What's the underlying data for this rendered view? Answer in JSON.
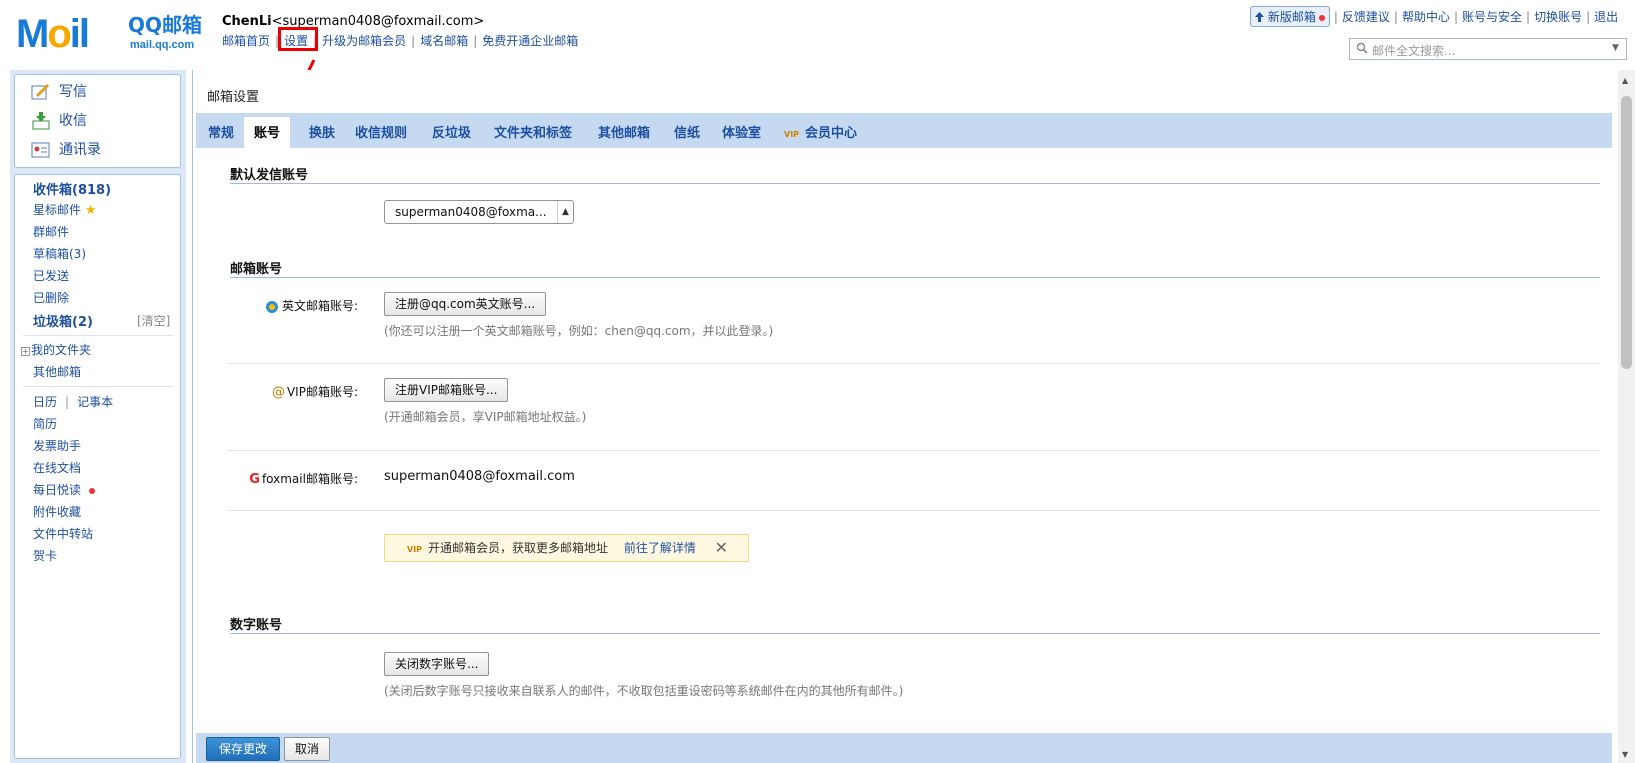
{
  "header": {
    "logo_text_m": "M",
    "logo_text_o": "o",
    "logo_text_il": "il",
    "logo_qq": "QQ邮箱",
    "logo_domain": "mail.qq.com",
    "user_name": "ChenLi",
    "user_email": "<superman0408@foxmail.com>",
    "nav": [
      "邮箱首页",
      "设置",
      "升级为邮箱会员",
      "域名邮箱",
      "免费开通企业邮箱"
    ],
    "right_links": {
      "new_version": "新版邮箱",
      "feedback": "反馈建议",
      "help": "帮助中心",
      "account_security": "账号与安全",
      "switch_account": "切换账号",
      "logout": "退出"
    },
    "search_placeholder": "邮件全文搜索..."
  },
  "sidebar": {
    "quick": {
      "compose": "写信",
      "inbox": "收信",
      "contacts": "通讯录"
    },
    "folders": {
      "inbox": "收件箱(818)",
      "starred": "星标邮件",
      "group": "群邮件",
      "drafts": "草稿箱(3)",
      "sent": "已发送",
      "deleted": "已删除",
      "spam": "垃圾箱(2)",
      "clear": "[清空]",
      "my_folders": "我的文件夹",
      "other_mail": "其他邮箱",
      "calendar": "日历",
      "notepad": "记事本",
      "resume": "简历",
      "invoice": "发票助手",
      "online_docs": "在线文档",
      "daily_read": "每日悦读",
      "attachments": "附件收藏",
      "file_transfer": "文件中转站",
      "greeting_card": "贺卡"
    }
  },
  "main": {
    "title": "邮箱设置",
    "tabs": [
      "常规",
      "账号",
      "换肤",
      "收信规则",
      "反垃圾",
      "文件夹和标签",
      "其他邮箱",
      "信纸",
      "体验室",
      "会员中心"
    ],
    "active_tab": "账号",
    "default_sender": {
      "heading": "默认发信账号",
      "select_value": "superman0408@foxma..."
    },
    "mail_accounts": {
      "heading": "邮箱账号",
      "english_label": "英文邮箱账号:",
      "english_button": "注册@qq.com英文账号...",
      "english_hint": "(你还可以注册一个英文邮箱账号，例如：chen@qq.com，并以此登录。)",
      "vip_label": "VIP邮箱账号:",
      "vip_button": "注册VIP邮箱账号...",
      "vip_hint": "(开通邮箱会员，享VIP邮箱地址权益。)",
      "foxmail_label": "foxmail邮箱账号:",
      "foxmail_value": "superman0408@foxmail.com",
      "vip_banner": "开通邮箱会员，获取更多邮箱地址",
      "vip_banner_link": "前往了解详情",
      "vip_banner_close": "✕"
    },
    "digital_account": {
      "heading": "数字账号",
      "button": "关闭数字账号...",
      "hint": "(关闭后数字账号只接收来自联系人的邮件，不收取包括重设密码等系统邮件在内的其他所有邮件。)"
    },
    "footer": {
      "save": "保存更改",
      "cancel": "取消"
    }
  },
  "colors": {
    "accent": "#1a7ad8",
    "tabbar": "#c5d9f1",
    "highlight": "#e00000",
    "save_button": "#2a7ec7"
  }
}
